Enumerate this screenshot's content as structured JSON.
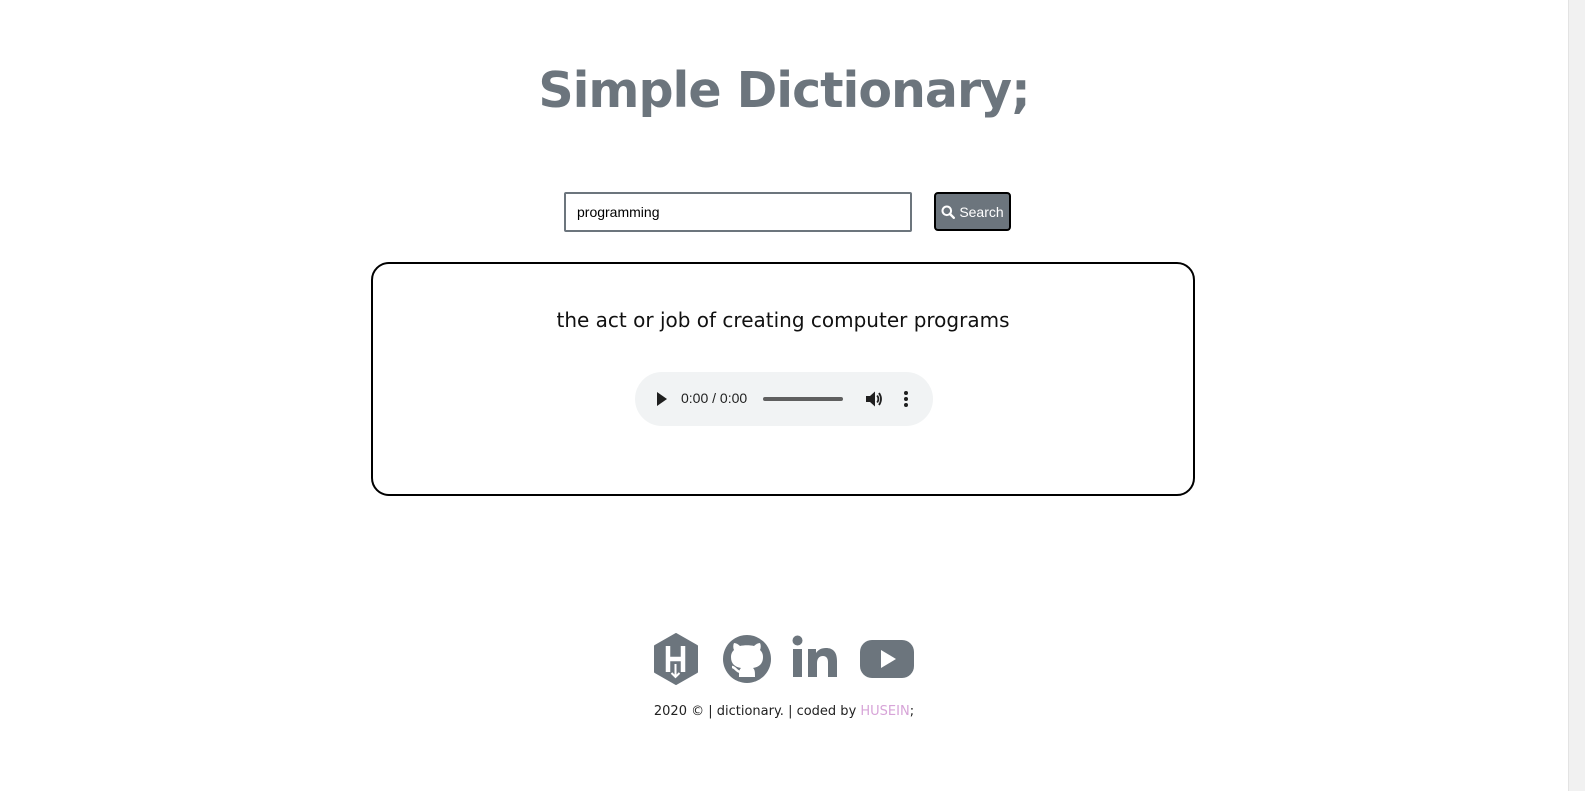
{
  "header": {
    "title": "Simple Dictionary;"
  },
  "search": {
    "value": "programming",
    "placeholder": "",
    "button_label": "Search"
  },
  "result": {
    "definition": "the act or job of creating computer programs",
    "audio": {
      "time": "0:00 / 0:00"
    }
  },
  "social": {
    "icons": [
      "hashnode-icon",
      "github-icon",
      "linkedin-icon",
      "youtube-icon"
    ],
    "color": "#6c757d"
  },
  "footer": {
    "prefix": "2020 © | dictionary. | coded by ",
    "author": "HUSEIN",
    "suffix": ";",
    "author_color": "#d7a4d8"
  },
  "colors": {
    "primary": "#6c757d",
    "border": "#000000",
    "audio_bg": "#f1f3f4"
  }
}
